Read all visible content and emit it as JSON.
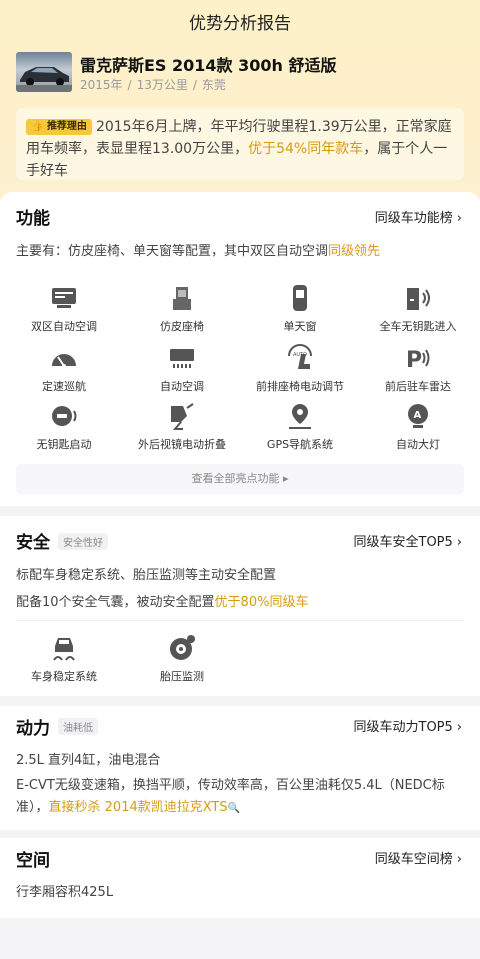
{
  "header": {
    "title": "优势分析报告"
  },
  "car": {
    "title": "雷克萨斯ES 2014款 300h 舒适版",
    "year": "2015年",
    "mileage": "13万公里",
    "city": "东莞",
    "separator": "/"
  },
  "reason": {
    "badge": "推荐理由",
    "text1": "2015年6月上牌，年平均行驶里程1.39万公里，正常家庭用车频率，表显里程13.00万公里，",
    "highlight": "优于54%同年款车",
    "text2": "，属于个人一手好车"
  },
  "features": {
    "title": "功能",
    "link": "同级车功能榜",
    "summary_text": "主要有：仿皮座椅、单天窗等配置，其中双区自动空调",
    "summary_highlight": "同级领先",
    "items": [
      {
        "label": "双区自动空调",
        "icon": "dual-zone-ac-icon"
      },
      {
        "label": "仿皮座椅",
        "icon": "leather-seat-icon"
      },
      {
        "label": "单天窗",
        "icon": "sunroof-icon"
      },
      {
        "label": "全车无钥匙进入",
        "icon": "keyless-entry-icon"
      },
      {
        "label": "定速巡航",
        "icon": "cruise-control-icon"
      },
      {
        "label": "自动空调",
        "icon": "auto-ac-icon"
      },
      {
        "label": "前排座椅电动调节",
        "icon": "power-seat-icon"
      },
      {
        "label": "前后驻车雷达",
        "icon": "parking-radar-icon"
      },
      {
        "label": "无钥匙启动",
        "icon": "keyless-start-icon"
      },
      {
        "label": "外后视镜电动折叠",
        "icon": "mirror-fold-icon"
      },
      {
        "label": "GPS导航系统",
        "icon": "gps-icon"
      },
      {
        "label": "自动大灯",
        "icon": "auto-headlight-icon"
      }
    ],
    "view_all": "查看全部亮点功能"
  },
  "safety": {
    "title": "安全",
    "tag": "安全性好",
    "link": "同级车安全TOP5",
    "line1": "标配车身稳定系统、胎压监测等主动安全配置",
    "line2_text": "配备10个安全气囊，被动安全配置",
    "line2_highlight": "优于80%同级车",
    "items": [
      {
        "label": "车身稳定系统",
        "icon": "stability-control-icon"
      },
      {
        "label": "胎压监测",
        "icon": "tire-pressure-icon"
      }
    ]
  },
  "power": {
    "title": "动力",
    "tag": "油耗低",
    "link": "同级车动力TOP5",
    "line1": "2.5L 直列4缸，油电混合",
    "line2_text": "E-CVT无级变速箱，换挡平顺，传动效率高，百公里油耗仅5.4L（NEDC标准），",
    "line2_highlight": "直接秒杀 2014款凯迪拉克XTS"
  },
  "space": {
    "title": "空间",
    "link": "同级车空间榜",
    "line1": "行李厢容积425L"
  },
  "colors": {
    "accent": "#d89b0f",
    "badge": "#f7c83c"
  }
}
